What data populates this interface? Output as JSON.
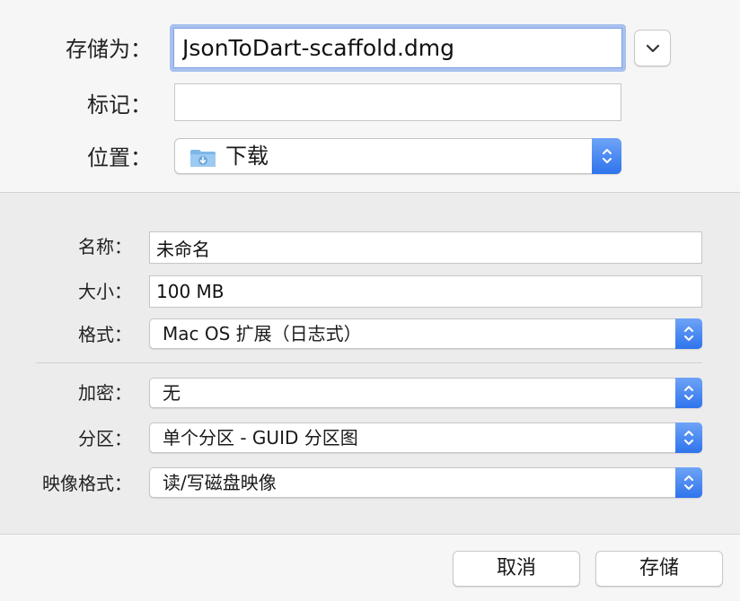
{
  "top": {
    "save_as_label": "存储为：",
    "save_as_value": "JsonToDart-scaffold.dmg",
    "tags_label": "标记：",
    "tags_value": "",
    "where_label": "位置：",
    "where_value": "下载",
    "where_icon": "downloads-folder-icon",
    "expand_icon": "chevron-down-icon"
  },
  "image_options": {
    "name_label": "名称：",
    "name_value": "未命名",
    "size_label": "大小：",
    "size_value": "100 MB",
    "format_label": "格式：",
    "format_value": "Mac OS 扩展（日志式）",
    "encryption_label": "加密：",
    "encryption_value": "无",
    "partitions_label": "分区：",
    "partitions_value": "单个分区 - GUID 分区图",
    "image_format_label": "映像格式：",
    "image_format_value": "读/写磁盘映像"
  },
  "footer": {
    "cancel_label": "取消",
    "save_label": "存储"
  },
  "colors": {
    "accent": "#3d7ef0",
    "focus_ring": "#a7c0ee",
    "folder": "#7fb6e8"
  }
}
